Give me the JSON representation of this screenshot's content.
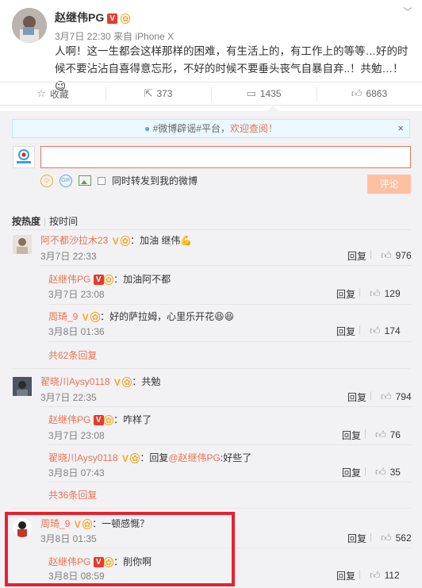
{
  "post": {
    "author": "赵继伟PG",
    "author_badge_v": "V",
    "meta": "3月7日 22:30 来自 iPhone X",
    "text": "人啊！这一生都会这样那样的困难，有生活上的，有工作上的等等…好的时候不要沾沾自喜得意忘形，不好的时候不要垂头丧气自暴自弃..！共勉…！",
    "emoji": "😉"
  },
  "actions": {
    "favorite": "收藏",
    "repost": "373",
    "comment": "1435",
    "like": "6863"
  },
  "notice": {
    "text_topic": "#微博辟谣#平台，",
    "text_link": "欢迎查阅！",
    "close": "×"
  },
  "composer": {
    "sync_label": "同时转发到我的微博",
    "submit_label": "评论",
    "gif_label": "GIF"
  },
  "sort": {
    "hot": "按热度",
    "time": "按时间"
  },
  "comments": [
    {
      "name": "阿不都沙拉木23",
      "text": "：加油 继伟💪",
      "date": "3月7日 22:33",
      "reply": "回复",
      "likes": "976",
      "replies": [
        {
          "name": "赵继伟PG",
          "text": "：加油阿不都",
          "date": "3月7日 23:08",
          "reply": "回复",
          "likes": "129"
        },
        {
          "name": "周琦_9",
          "text": "：好的萨拉姆，心里乐开花😆😆",
          "date": "3月8日 01:36",
          "reply": "回复",
          "likes": "174"
        }
      ],
      "more": "共62条回复"
    },
    {
      "name": "翟晓川Aysy0118",
      "text": "：共勉",
      "date": "3月7日 22:35",
      "reply": "回复",
      "likes": "794",
      "replies": [
        {
          "name": "赵继伟PG",
          "text": "：咋样了",
          "date": "3月7日 23:08",
          "reply": "回复",
          "likes": "76"
        },
        {
          "name": "翟晓川Aysy0118",
          "text": "：回复",
          "mention": "@赵继伟PG",
          "text2": ":好些了",
          "date": "3月8日 07:43",
          "reply": "回复",
          "likes": "35"
        }
      ],
      "more": "共36条回复"
    },
    {
      "name": "周琦_9",
      "text": "：一顿感慨？",
      "date": "3月8日 01:35",
      "reply": "回复",
      "likes": "562",
      "replies": [
        {
          "name": "赵继伟PG",
          "text": "：削你啊",
          "date": "3月8日 08:59",
          "reply": "回复",
          "likes": "112"
        }
      ]
    }
  ],
  "colors": {
    "accent": "#eb7350",
    "highlight_box": "#e8212c",
    "comment_bg": "#f2f2f5"
  }
}
